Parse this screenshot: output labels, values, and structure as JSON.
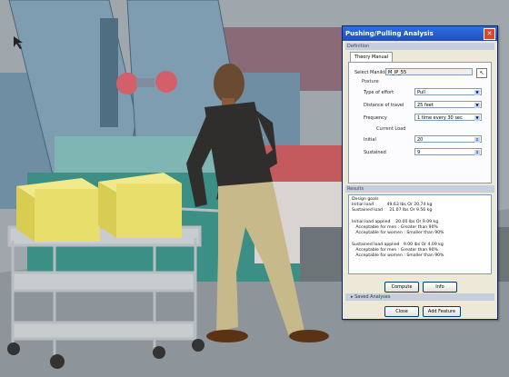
{
  "dialog": {
    "title": "Pushing/Pulling Analysis",
    "close_glyph": "✕",
    "section_definition": "Definition",
    "tab_label": "Theory Manual",
    "select_manikin_label": "Select Manikin",
    "select_manikin_value": "M_IP_55",
    "posture_label": "Posture",
    "type_of_effort_label": "Type of effort",
    "type_of_effort_value": "Pull",
    "distance_label": "Distance of travel",
    "distance_value": "25 feet",
    "frequency_label": "Frequency",
    "frequency_value": "1 time every 30 sec",
    "current_load_label": "Current Load",
    "initial_label": "Initial",
    "initial_value": "20",
    "sustained_label": "Sustained",
    "sustained_value": "9",
    "section_results": "Results",
    "results_text": "Design goals\nInitial load          49.63 lbs Or 20.74 kg\nSustained load     21.07 lbs Or 9.56 kg\n\nInitial load applied    20.00 lbs Or 9.09 kg\n   Acceptable for men : Greater than 90%\n   Acceptable for women : Smaller than 90%\n\nSustained load applied   9.00 lbs Or 4.09 kg\n   Acceptable for men : Greater than 90%\n   Acceptable for women : Smaller than 90%",
    "compute_label": "Compute",
    "info_label": "Info",
    "saved_analyses_label": "Saved Analyses",
    "close_label": "Close",
    "add_feature_label": "Add Feature"
  }
}
